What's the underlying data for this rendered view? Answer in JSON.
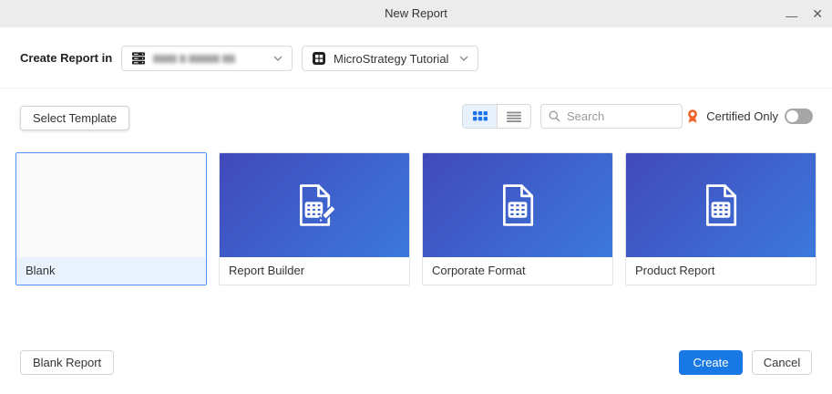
{
  "window": {
    "title": "New Report",
    "minimize_glyph": "—",
    "close_glyph": "✕"
  },
  "toolbar": {
    "create_report_in_label": "Create Report in",
    "server_dropdown": {
      "value_redacted": true,
      "icon": "server-icon"
    },
    "project_dropdown": {
      "value": "MicroStrategy Tutorial",
      "icon": "project-grid-icon"
    }
  },
  "filters": {
    "select_template_label": "Select Template",
    "view_mode": "grid",
    "search_placeholder": "Search",
    "certified_only_label": "Certified Only",
    "certified_toggle_state": "off"
  },
  "templates": [
    {
      "label": "Blank",
      "selected": true,
      "thumbnail": "empty"
    },
    {
      "label": "Report Builder",
      "selected": false,
      "thumbnail": "document-table-pencil-icon"
    },
    {
      "label": "Corporate Format",
      "selected": false,
      "thumbnail": "document-table-icon"
    },
    {
      "label": "Product Report",
      "selected": false,
      "thumbnail": "document-table-icon"
    }
  ],
  "footer": {
    "blank_report_label": "Blank Report",
    "create_label": "Create",
    "cancel_label": "Cancel"
  },
  "colors": {
    "accent_blue": "#1878e4",
    "grid_icon_blue": "#1a73e8",
    "card_gradient_start": "#4149bb",
    "card_gradient_end": "#3c79dc",
    "certified_orange": "#f26427",
    "selected_border": "#4f92f7",
    "selected_label_bg": "#e9f2fd",
    "titlebar_bg": "#ececec"
  }
}
